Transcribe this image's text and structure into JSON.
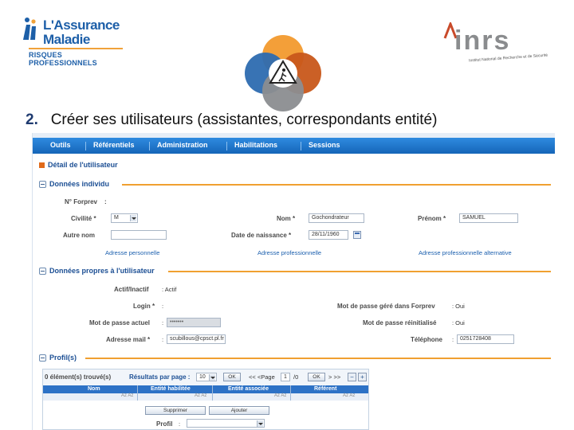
{
  "header": {
    "left_logo": {
      "line1": "L'Assurance",
      "line2": "Maladie",
      "line3": "RISQUES PROFESSIONNELS"
    },
    "right_logo": {
      "word": "inrs",
      "subtitle": "Institut National de Recherche et de Sécurité"
    },
    "title_number": "2.",
    "title_text": "Créer ses utilisateurs (assistantes, correspondants entité)"
  },
  "app": {
    "menu": [
      "Outils",
      "Référentiels",
      "Administration",
      "Habilitations",
      "Sessions"
    ],
    "detail_title": "Détail de l'utilisateur",
    "personal": {
      "section": "Données individu",
      "forprev_label": "N° Forprev",
      "forprev_sep": ":",
      "civilite_label": "Civilité *",
      "civilite_value": "M",
      "nom_label": "Nom *",
      "nom_value": "Gochondrateur",
      "prenom_label": "Prénom *",
      "prenom_value": "SAMUEL",
      "autre_nom_label": "Autre nom",
      "autre_nom_value": "",
      "naissance_label": "Date de naissance *",
      "naissance_value": "28/11/1960",
      "links": [
        "Adresse personnelle",
        "Adresse professionnelle",
        "Adresse professionnelle alternative"
      ]
    },
    "user": {
      "section": "Données propres à l'utilisateur",
      "actif_label": "Actif/Inactif",
      "actif_value": "Actif",
      "login_label": "Login *",
      "login_value": "",
      "mdp_label": "Mot de passe actuel",
      "mdp_value": "•••••••",
      "mail_label": "Adresse mail *",
      "mail_value": "scubillous@cpsct.pl.fr",
      "gere_label": "Mot de passe géré dans Forprev",
      "gere_value": "Oui",
      "reinit_label": "Mot de passe réinitialisé",
      "reinit_value": "Oui",
      "tel_label": "Téléphone",
      "tel_value": "0251728408"
    },
    "profils": {
      "section": "Profil(s)",
      "found": "0 élément(s) trouvé(s)",
      "per_page_label": "Résultats par page :",
      "per_page_value": "10",
      "ok1": "OK",
      "nav_prev": "<< <Page",
      "page_value": "1",
      "page_total": "/0",
      "ok2": "OK",
      "nav_next": "> >>",
      "columns": [
        "Nom",
        "Entité habilitée",
        "Entité associée",
        "Référent"
      ],
      "sub_columns": [
        "Az Az",
        "Az Az",
        "Az Az",
        "Az Az"
      ],
      "btn_delete": "Supprimer",
      "btn_add": "Ajouter",
      "profil_label": "Profil",
      "profil_sep": ":"
    }
  },
  "colors": {
    "menubar": "#1b6fc8",
    "accent_orange": "#f0a030",
    "section_text": "#1c4f94"
  }
}
